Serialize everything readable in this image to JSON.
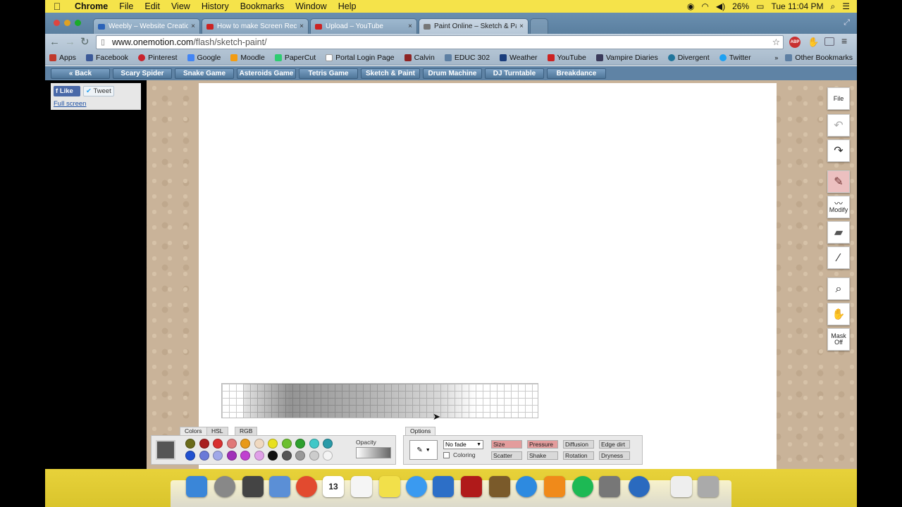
{
  "menubar": {
    "app_name": "Chrome",
    "items": [
      "File",
      "Edit",
      "View",
      "History",
      "Bookmarks",
      "Window",
      "Help"
    ],
    "battery": "26%",
    "clock": "Tue 11:04 PM"
  },
  "tabs": [
    {
      "label": "Weebly – Website Creation",
      "color": "#2a62b8"
    },
    {
      "label": "How to make Screen Reco",
      "color": "#cc2222"
    },
    {
      "label": "Upload – YouTube",
      "color": "#cc2222"
    },
    {
      "label": "Paint Online – Sketch & Pa",
      "color": "#666666",
      "active": true
    }
  ],
  "omnibox": {
    "host": "www.onemotion.com",
    "path": "/flash/sketch-paint/"
  },
  "bookmarks": [
    {
      "label": "Apps",
      "color": "#c0392b"
    },
    {
      "label": "Facebook",
      "color": "#3b5998"
    },
    {
      "label": "Pinterest",
      "color": "#c8232c"
    },
    {
      "label": "Google",
      "color": "#4285f4"
    },
    {
      "label": "Moodle",
      "color": "#f39c12"
    },
    {
      "label": "PaperCut",
      "color": "#2ecc71"
    },
    {
      "label": "Portal Login Page",
      "color": "#ffffff"
    },
    {
      "label": "Calvin",
      "color": "#8e2424"
    },
    {
      "label": "EDUC 302",
      "color": "#5d7fa3"
    },
    {
      "label": "Weather",
      "color": "#1a3d7c"
    },
    {
      "label": "YouTube",
      "color": "#cc2222"
    },
    {
      "label": "Vampire Diaries",
      "color": "#3a3a5a"
    },
    {
      "label": "Divergent",
      "color": "#21759b"
    },
    {
      "label": "Twitter",
      "color": "#1da1f2"
    }
  ],
  "other_bookmarks": "Other Bookmarks",
  "site_nav": [
    "« Back",
    "Scary Spider",
    "Snake Game",
    "Asteroids Game",
    "Tetris Game",
    "Sketch & Paint",
    "Drum Machine",
    "DJ Turntable",
    "Breakdance"
  ],
  "social": {
    "like": "Like",
    "tweet": "Tweet",
    "fullscreen": "Full screen"
  },
  "tools": {
    "file": "File",
    "modify": "Modify",
    "mask": "Mask Off"
  },
  "color_panel": {
    "tabs": [
      "Colors",
      "HSL",
      "RGB"
    ],
    "current_color": "#555555",
    "opacity_label": "Opacity",
    "palette_row1": [
      "#6b6b1a",
      "#a82020",
      "#d83030",
      "#e07878",
      "#e89a1a",
      "#f0d9c0",
      "#e8e020",
      "#6cc030",
      "#2ea02e",
      "#40c8c8",
      "#2a9aa8"
    ],
    "palette_row2": [
      "#2050d0",
      "#6a7ad8",
      "#a0a8e8",
      "#a030b8",
      "#c040d0",
      "#e0a0e8",
      "#111111",
      "#555555",
      "#999999",
      "#cccccc",
      "#f4f4f4"
    ]
  },
  "options_panel": {
    "title": "Options",
    "fade": "No fade",
    "coloring": "Coloring",
    "buttons_row1": [
      {
        "label": "Size",
        "active": true
      },
      {
        "label": "Pressure",
        "active": true
      },
      {
        "label": "Diffusion",
        "active": false
      },
      {
        "label": "Edge dirt",
        "active": false
      }
    ],
    "buttons_row2": [
      {
        "label": "Scatter",
        "active": false
      },
      {
        "label": "Shake",
        "active": false
      },
      {
        "label": "Rotation",
        "active": false
      },
      {
        "label": "Dryness",
        "active": false
      }
    ]
  },
  "dock": [
    {
      "name": "finder-icon",
      "color": "#3a86d8"
    },
    {
      "name": "launchpad-icon",
      "color": "#888888"
    },
    {
      "name": "mission-control-icon",
      "color": "#444444"
    },
    {
      "name": "mail-icon",
      "color": "#5b8fd6"
    },
    {
      "name": "chrome-icon",
      "color": "#e24a2f"
    },
    {
      "name": "calendar-icon",
      "color": "#ffffff"
    },
    {
      "name": "reminders-icon",
      "color": "#f5f5f5"
    },
    {
      "name": "stickies-icon",
      "color": "#f2e04a"
    },
    {
      "name": "messages-icon",
      "color": "#3a9af0"
    },
    {
      "name": "openoffice-icon",
      "color": "#2d6fc7"
    },
    {
      "name": "photo-booth-icon",
      "color": "#b01a1a"
    },
    {
      "name": "iphoto-icon",
      "color": "#7a5a2a"
    },
    {
      "name": "itunes-icon",
      "color": "#2d8ae0"
    },
    {
      "name": "ibooks-icon",
      "color": "#f08a1a"
    },
    {
      "name": "spotify-icon",
      "color": "#1db954"
    },
    {
      "name": "system-preferences-icon",
      "color": "#777777"
    },
    {
      "name": "quicktime-icon",
      "color": "#2a6abf"
    },
    {
      "name": "document-icon",
      "color": "#eeeeee"
    },
    {
      "name": "trash-icon",
      "color": "#aaaaaa"
    }
  ],
  "calendar_day": "13"
}
